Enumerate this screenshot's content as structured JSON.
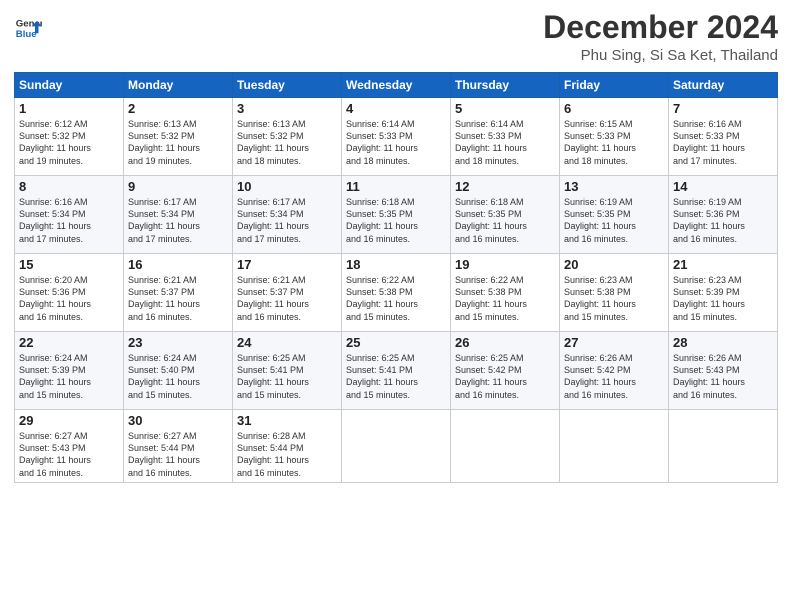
{
  "logo": {
    "line1": "General",
    "line2": "Blue"
  },
  "title": "December 2024",
  "location": "Phu Sing, Si Sa Ket, Thailand",
  "weekdays": [
    "Sunday",
    "Monday",
    "Tuesday",
    "Wednesday",
    "Thursday",
    "Friday",
    "Saturday"
  ],
  "weeks": [
    [
      {
        "day": "1",
        "info": "Sunrise: 6:12 AM\nSunset: 5:32 PM\nDaylight: 11 hours\nand 19 minutes."
      },
      {
        "day": "2",
        "info": "Sunrise: 6:13 AM\nSunset: 5:32 PM\nDaylight: 11 hours\nand 19 minutes."
      },
      {
        "day": "3",
        "info": "Sunrise: 6:13 AM\nSunset: 5:32 PM\nDaylight: 11 hours\nand 18 minutes."
      },
      {
        "day": "4",
        "info": "Sunrise: 6:14 AM\nSunset: 5:33 PM\nDaylight: 11 hours\nand 18 minutes."
      },
      {
        "day": "5",
        "info": "Sunrise: 6:14 AM\nSunset: 5:33 PM\nDaylight: 11 hours\nand 18 minutes."
      },
      {
        "day": "6",
        "info": "Sunrise: 6:15 AM\nSunset: 5:33 PM\nDaylight: 11 hours\nand 18 minutes."
      },
      {
        "day": "7",
        "info": "Sunrise: 6:16 AM\nSunset: 5:33 PM\nDaylight: 11 hours\nand 17 minutes."
      }
    ],
    [
      {
        "day": "8",
        "info": "Sunrise: 6:16 AM\nSunset: 5:34 PM\nDaylight: 11 hours\nand 17 minutes."
      },
      {
        "day": "9",
        "info": "Sunrise: 6:17 AM\nSunset: 5:34 PM\nDaylight: 11 hours\nand 17 minutes."
      },
      {
        "day": "10",
        "info": "Sunrise: 6:17 AM\nSunset: 5:34 PM\nDaylight: 11 hours\nand 17 minutes."
      },
      {
        "day": "11",
        "info": "Sunrise: 6:18 AM\nSunset: 5:35 PM\nDaylight: 11 hours\nand 16 minutes."
      },
      {
        "day": "12",
        "info": "Sunrise: 6:18 AM\nSunset: 5:35 PM\nDaylight: 11 hours\nand 16 minutes."
      },
      {
        "day": "13",
        "info": "Sunrise: 6:19 AM\nSunset: 5:35 PM\nDaylight: 11 hours\nand 16 minutes."
      },
      {
        "day": "14",
        "info": "Sunrise: 6:19 AM\nSunset: 5:36 PM\nDaylight: 11 hours\nand 16 minutes."
      }
    ],
    [
      {
        "day": "15",
        "info": "Sunrise: 6:20 AM\nSunset: 5:36 PM\nDaylight: 11 hours\nand 16 minutes."
      },
      {
        "day": "16",
        "info": "Sunrise: 6:21 AM\nSunset: 5:37 PM\nDaylight: 11 hours\nand 16 minutes."
      },
      {
        "day": "17",
        "info": "Sunrise: 6:21 AM\nSunset: 5:37 PM\nDaylight: 11 hours\nand 16 minutes."
      },
      {
        "day": "18",
        "info": "Sunrise: 6:22 AM\nSunset: 5:38 PM\nDaylight: 11 hours\nand 15 minutes."
      },
      {
        "day": "19",
        "info": "Sunrise: 6:22 AM\nSunset: 5:38 PM\nDaylight: 11 hours\nand 15 minutes."
      },
      {
        "day": "20",
        "info": "Sunrise: 6:23 AM\nSunset: 5:38 PM\nDaylight: 11 hours\nand 15 minutes."
      },
      {
        "day": "21",
        "info": "Sunrise: 6:23 AM\nSunset: 5:39 PM\nDaylight: 11 hours\nand 15 minutes."
      }
    ],
    [
      {
        "day": "22",
        "info": "Sunrise: 6:24 AM\nSunset: 5:39 PM\nDaylight: 11 hours\nand 15 minutes."
      },
      {
        "day": "23",
        "info": "Sunrise: 6:24 AM\nSunset: 5:40 PM\nDaylight: 11 hours\nand 15 minutes."
      },
      {
        "day": "24",
        "info": "Sunrise: 6:25 AM\nSunset: 5:41 PM\nDaylight: 11 hours\nand 15 minutes."
      },
      {
        "day": "25",
        "info": "Sunrise: 6:25 AM\nSunset: 5:41 PM\nDaylight: 11 hours\nand 15 minutes."
      },
      {
        "day": "26",
        "info": "Sunrise: 6:25 AM\nSunset: 5:42 PM\nDaylight: 11 hours\nand 16 minutes."
      },
      {
        "day": "27",
        "info": "Sunrise: 6:26 AM\nSunset: 5:42 PM\nDaylight: 11 hours\nand 16 minutes."
      },
      {
        "day": "28",
        "info": "Sunrise: 6:26 AM\nSunset: 5:43 PM\nDaylight: 11 hours\nand 16 minutes."
      }
    ],
    [
      {
        "day": "29",
        "info": "Sunrise: 6:27 AM\nSunset: 5:43 PM\nDaylight: 11 hours\nand 16 minutes."
      },
      {
        "day": "30",
        "info": "Sunrise: 6:27 AM\nSunset: 5:44 PM\nDaylight: 11 hours\nand 16 minutes."
      },
      {
        "day": "31",
        "info": "Sunrise: 6:28 AM\nSunset: 5:44 PM\nDaylight: 11 hours\nand 16 minutes."
      },
      {
        "day": "",
        "info": ""
      },
      {
        "day": "",
        "info": ""
      },
      {
        "day": "",
        "info": ""
      },
      {
        "day": "",
        "info": ""
      }
    ]
  ]
}
